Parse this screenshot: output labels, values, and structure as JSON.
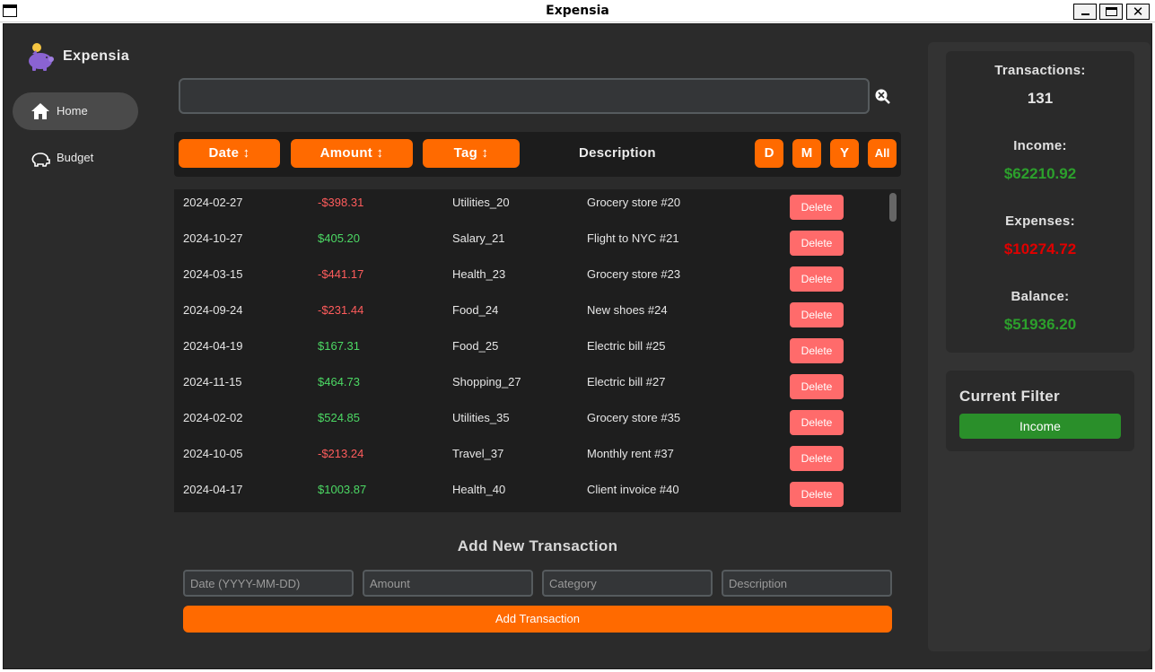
{
  "window": {
    "title": "Expensia"
  },
  "sidebar": {
    "brand": "Expensia",
    "items": [
      {
        "label": "Home",
        "icon": "home-icon",
        "active": true
      },
      {
        "label": "Budget",
        "icon": "budget-icon",
        "active": false
      }
    ]
  },
  "search": {
    "placeholder": "",
    "value": ""
  },
  "table_header": {
    "date_label": "Date ↕",
    "amount_label": "Amount ↕",
    "tag_label": "Tag ↕",
    "description_label": "Description",
    "filters": [
      "D",
      "M",
      "Y",
      "All"
    ],
    "accent": "#ff6a00"
  },
  "transactions": [
    {
      "date": "2024-02-27",
      "amount": "-$398.31",
      "type": "expense",
      "tag": "Utilities_20",
      "description": "Grocery store #20",
      "action": "Delete"
    },
    {
      "date": "2024-10-27",
      "amount": "$405.20",
      "type": "income",
      "tag": "Salary_21",
      "description": "Flight to NYC #21",
      "action": "Delete"
    },
    {
      "date": "2024-03-15",
      "amount": "-$441.17",
      "type": "expense",
      "tag": "Health_23",
      "description": "Grocery store #23",
      "action": "Delete"
    },
    {
      "date": "2024-09-24",
      "amount": "-$231.44",
      "type": "expense",
      "tag": "Food_24",
      "description": "New shoes #24",
      "action": "Delete"
    },
    {
      "date": "2024-04-19",
      "amount": "$167.31",
      "type": "income",
      "tag": "Food_25",
      "description": "Electric bill #25",
      "action": "Delete"
    },
    {
      "date": "2024-11-15",
      "amount": "$464.73",
      "type": "income",
      "tag": "Shopping_27",
      "description": "Electric bill #27",
      "action": "Delete"
    },
    {
      "date": "2024-02-02",
      "amount": "$524.85",
      "type": "income",
      "tag": "Utilities_35",
      "description": "Grocery store #35",
      "action": "Delete"
    },
    {
      "date": "2024-10-05",
      "amount": "-$213.24",
      "type": "expense",
      "tag": "Travel_37",
      "description": "Monthly rent #37",
      "action": "Delete"
    },
    {
      "date": "2024-04-17",
      "amount": "$1003.87",
      "type": "income",
      "tag": "Health_40",
      "description": "Client invoice #40",
      "action": "Delete"
    }
  ],
  "add_form": {
    "title": "Add New Transaction",
    "date_placeholder": "Date (YYYY-MM-DD)",
    "amount_placeholder": "Amount",
    "category_placeholder": "Category",
    "description_placeholder": "Description",
    "submit_label": "Add Transaction"
  },
  "stats": {
    "transactions_label": "Transactions:",
    "transactions_value": "131",
    "income_label": "Income:",
    "income_value": "$62210.92",
    "expenses_label": "Expenses:",
    "expenses_value": "$10274.72",
    "balance_label": "Balance:",
    "balance_value": "$51936.20",
    "income_color": "#2ca02c",
    "expense_color": "#e00000"
  },
  "current_filter": {
    "title": "Current Filter",
    "value": "Income",
    "color": "#2a8f2a"
  }
}
